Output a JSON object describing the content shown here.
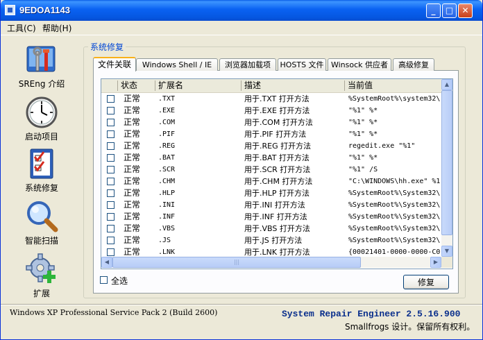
{
  "window": {
    "title": "9EDOA1143",
    "buttons": {
      "minimize": "_",
      "maximize": "□",
      "close": "✕"
    }
  },
  "menu": {
    "tools": "工具(C)",
    "help": "帮助(H)"
  },
  "nav": [
    {
      "label": "SREng 介绍",
      "icon": "tools-icon"
    },
    {
      "label": "启动项目",
      "icon": "clock-icon"
    },
    {
      "label": "系统修复",
      "icon": "checklist-icon"
    },
    {
      "label": "智能扫描",
      "icon": "magnifier-icon"
    },
    {
      "label": "扩展",
      "icon": "gear-plus-icon"
    }
  ],
  "group": {
    "title": "系统修复"
  },
  "tabs": [
    {
      "label": "文件关联",
      "active": true
    },
    {
      "label": "Windows Shell / IE"
    },
    {
      "label": "浏览器加载项"
    },
    {
      "label": "HOSTS 文件"
    },
    {
      "label": "Winsock 供应者"
    },
    {
      "label": "高级修复"
    }
  ],
  "columns": {
    "status": "状态",
    "ext": "扩展名",
    "desc": "描述",
    "current": "当前值"
  },
  "rows": [
    {
      "status": "正常",
      "ext": ".TXT",
      "desc": "用于.TXT 打开方法",
      "current": "%SystemRoot%\\system32\\"
    },
    {
      "status": "正常",
      "ext": ".EXE",
      "desc": "用于.EXE 打开方法",
      "current": "\"%1\" %*"
    },
    {
      "status": "正常",
      "ext": ".COM",
      "desc": "用于.COM 打开方法",
      "current": "\"%1\" %*"
    },
    {
      "status": "正常",
      "ext": ".PIF",
      "desc": "用于.PIF 打开方法",
      "current": "\"%1\" %*"
    },
    {
      "status": "正常",
      "ext": ".REG",
      "desc": "用于.REG 打开方法",
      "current": "regedit.exe \"%1\""
    },
    {
      "status": "正常",
      "ext": ".BAT",
      "desc": "用于.BAT 打开方法",
      "current": "\"%1\" %*"
    },
    {
      "status": "正常",
      "ext": ".SCR",
      "desc": "用于.SCR 打开方法",
      "current": "\"%1\" /S"
    },
    {
      "status": "正常",
      "ext": ".CHM",
      "desc": "用于.CHM 打开方法",
      "current": "\"C:\\WINDOWS\\hh.exe\" %1"
    },
    {
      "status": "正常",
      "ext": ".HLP",
      "desc": "用于.HLP 打开方法",
      "current": "%SystemRoot%\\System32\\"
    },
    {
      "status": "正常",
      "ext": ".INI",
      "desc": "用于.INI 打开方法",
      "current": "%SystemRoot%\\System32\\"
    },
    {
      "status": "正常",
      "ext": ".INF",
      "desc": "用于.INF 打开方法",
      "current": "%SystemRoot%\\System32\\"
    },
    {
      "status": "正常",
      "ext": ".VBS",
      "desc": "用于.VBS 打开方法",
      "current": "%SystemRoot%\\System32\\"
    },
    {
      "status": "正常",
      "ext": ".JS",
      "desc": "用于.JS 打开方法",
      "current": "%SystemRoot%\\System32\\"
    },
    {
      "status": "正常",
      "ext": ".LNK",
      "desc": "用于.LNK 打开方法",
      "current": "{00021401-0000-0000-C0"
    }
  ],
  "controls": {
    "select_all": "全选",
    "repair": "修复"
  },
  "status": {
    "os": "Windows XP Professional Service Pack 2 (Build 2600)",
    "product": "System Repair Engineer 2.5.16.900",
    "copyright": "Smallfrogs 设计。保留所有权利。"
  },
  "colors": {
    "titlebar": "#0A62F2",
    "accent_tab": "#F9B119",
    "group_title": "#0046D5",
    "product_text": "#0A2F8C"
  }
}
